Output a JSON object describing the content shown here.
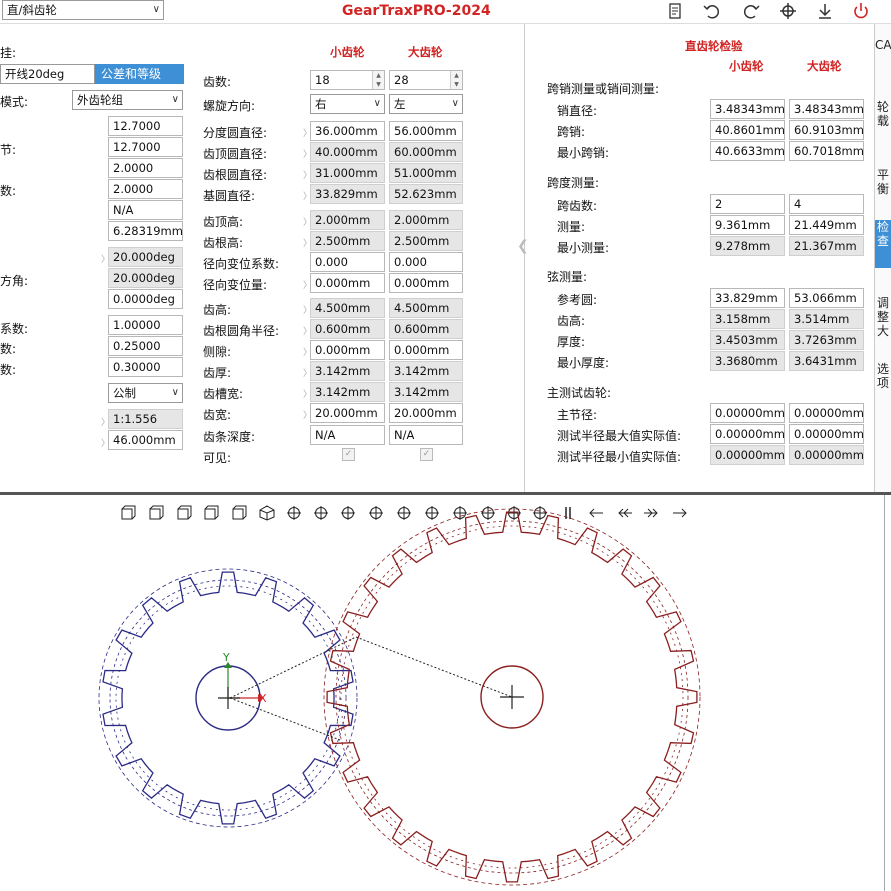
{
  "toolbar": {
    "type_select": "直/斜齿轮",
    "title": "GearTraxPRO-2024"
  },
  "left": {
    "labels": [
      "挂:",
      "模式:",
      "节:",
      "数:",
      "方角:",
      "系数:",
      "数:",
      "数:"
    ],
    "standard": "开线20deg",
    "tolerance_button": "公差和等级",
    "mode_select": "外齿轮组",
    "values": [
      "12.7000",
      "12.7000",
      "2.0000",
      "2.0000",
      "N/A",
      "6.28319mm"
    ],
    "angles": [
      "20.000deg",
      "20.000deg",
      "0.0000deg"
    ],
    "coeffs": [
      "1.00000",
      "0.25000",
      "0.30000"
    ],
    "unit_select": "公制",
    "ratio": "1:1.556",
    "center": "46.000mm"
  },
  "mid": {
    "col_small": "小齿轮",
    "col_large": "大齿轮",
    "rows": [
      {
        "label": "齿数:",
        "a": "18",
        "b": "28"
      },
      {
        "label": "螺旋方向:",
        "a": "右",
        "b": "左"
      },
      {
        "label": "分度圆直径:",
        "a": "36.000mm",
        "b": "56.000mm"
      },
      {
        "label": "齿顶圆直径:",
        "a": "40.000mm",
        "b": "60.000mm"
      },
      {
        "label": "齿根圆直径:",
        "a": "31.000mm",
        "b": "51.000mm"
      },
      {
        "label": "基圆直径:",
        "a": "33.829mm",
        "b": "52.623mm"
      },
      {
        "label": "齿顶高:",
        "a": "2.000mm",
        "b": "2.000mm"
      },
      {
        "label": "齿根高:",
        "a": "2.500mm",
        "b": "2.500mm"
      },
      {
        "label": "径向变位系数:",
        "a": "0.000",
        "b": "0.000"
      },
      {
        "label": "径向变位量:",
        "a": "0.000mm",
        "b": "0.000mm"
      },
      {
        "label": "齿高:",
        "a": "4.500mm",
        "b": "4.500mm"
      },
      {
        "label": "齿根圆角半径:",
        "a": "0.600mm",
        "b": "0.600mm"
      },
      {
        "label": "侧隙:",
        "a": "0.000mm",
        "b": "0.000mm"
      },
      {
        "label": "齿厚:",
        "a": "3.142mm",
        "b": "3.142mm"
      },
      {
        "label": "齿槽宽:",
        "a": "3.142mm",
        "b": "3.142mm"
      },
      {
        "label": "齿宽:",
        "a": "20.000mm",
        "b": "20.000mm"
      },
      {
        "label": "齿条深度:",
        "a": "N/A",
        "b": "N/A"
      },
      {
        "label": "可见:",
        "a": "",
        "b": ""
      }
    ]
  },
  "right": {
    "title": "直齿轮检验",
    "col_small": "小齿轮",
    "col_large": "大齿轮",
    "sec1": "跨销测量或销间测量:",
    "sec1_rows": [
      {
        "label": "销直径:",
        "a": "3.48343mm",
        "b": "3.48343mm"
      },
      {
        "label": "跨销:",
        "a": "40.8601mm",
        "b": "60.9103mm"
      },
      {
        "label": "最小跨销:",
        "a": "40.6633mm",
        "b": "60.7018mm"
      }
    ],
    "sec2": "跨度测量:",
    "sec2_rows": [
      {
        "label": "跨齿数:",
        "a": "2",
        "b": "4"
      },
      {
        "label": "测量:",
        "a": "9.361mm",
        "b": "21.449mm"
      },
      {
        "label": "最小测量:",
        "a": "9.278mm",
        "b": "21.367mm"
      }
    ],
    "sec3": "弦测量:",
    "sec3_rows": [
      {
        "label": "参考圆:",
        "a": "33.829mm",
        "b": "53.066mm"
      },
      {
        "label": "齿高:",
        "a": "3.158mm",
        "b": "3.514mm"
      },
      {
        "label": "厚度:",
        "a": "3.4503mm",
        "b": "3.7263mm"
      },
      {
        "label": "最小厚度:",
        "a": "3.3680mm",
        "b": "3.6431mm"
      }
    ],
    "sec4": "主测试齿轮:",
    "sec4_rows": [
      {
        "label": "主节径:",
        "a": "0.00000mm",
        "b": "0.00000mm"
      },
      {
        "label": "测试半径最大值实际值:",
        "a": "0.00000mm",
        "b": "0.00000mm"
      },
      {
        "label": "测试半径最小值实际值:",
        "a": "0.00000mm",
        "b": "0.00000mm"
      }
    ]
  },
  "side_tabs": [
    "CAD",
    "轮载",
    "平衡",
    "检查",
    "调整大",
    "选项"
  ],
  "canvas": {
    "axis_x": "X",
    "axis_y": "Y"
  },
  "colors": {
    "pinion": "#2b2b86",
    "gear": "#8a1f1f",
    "accent": "#d12424",
    "active_tab": "#3d8fd6"
  }
}
